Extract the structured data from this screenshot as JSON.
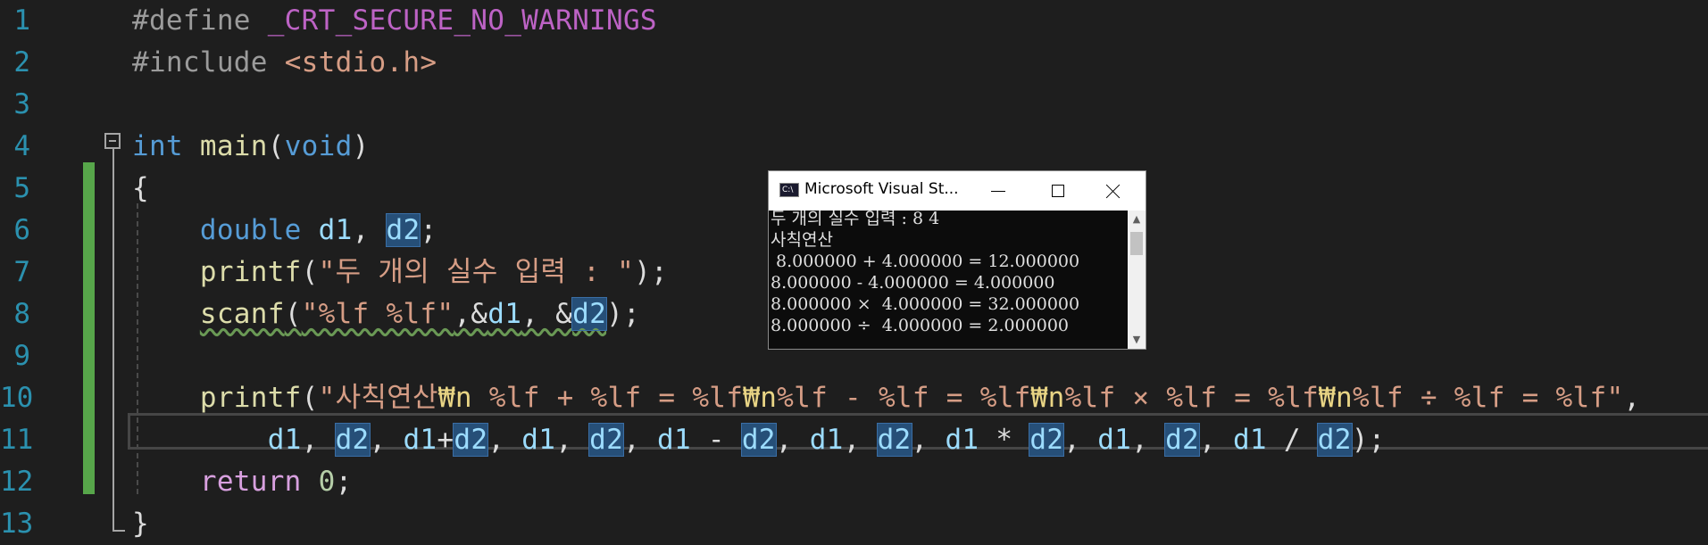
{
  "editor": {
    "line_numbers": [
      "1",
      "2",
      "3",
      "4",
      "5",
      "6",
      "7",
      "8",
      "9",
      "10",
      "11",
      "12",
      "13"
    ],
    "lines": {
      "l1": {
        "pre": "#define",
        "macro": "_CRT_SECURE_NO_WARNINGS"
      },
      "l2": {
        "pre": "#include",
        "header": "<stdio.h>"
      },
      "l4": {
        "kw": "int",
        "fn": "main",
        "open": "(",
        "param": "void",
        "close": ")"
      },
      "l5": {
        "brace": "{"
      },
      "l6": {
        "kw": "double",
        "v1": "d1",
        "comma": ",",
        "v2": "d2",
        "semi": ";"
      },
      "l7": {
        "fn": "printf",
        "open": "(",
        "str": "\"두 개의 실수 입력 : \"",
        "close": ");"
      },
      "l8": {
        "fn": "scanf",
        "open": "(",
        "str": "\"%lf %lf\"",
        "a": ",&",
        "v1": "d1",
        "b": ", &",
        "v2": "d2",
        "close": ");"
      },
      "l10": {
        "fn": "printf",
        "open": "(",
        "s1": "\"사칙연산",
        "e1": "₩n",
        "s2": " %lf + %lf = %lf",
        "e2": "₩n",
        "s3": "%lf - %lf = %lf",
        "e3": "₩n",
        "s4": "%lf × %lf = %lf",
        "e4": "₩n",
        "s5": "%lf ÷ %lf = %lf\"",
        "tail": ","
      },
      "l11": {
        "p1": "d1",
        "s1": ", ",
        "p2": "d2",
        "s2": ", ",
        "p3": "d1",
        "s3": "+",
        "p4": "d2",
        "s4": ", ",
        "p5": "d1",
        "s5": ", ",
        "p6": "d2",
        "s6": ", ",
        "p7": "d1",
        "s7": " - ",
        "p8": "d2",
        "s8": ", ",
        "p9": "d1",
        "s9": ", ",
        "p10": "d2",
        "s10": ", ",
        "p11": "d1",
        "s11": " * ",
        "p12": "d2",
        "s12": ", ",
        "p13": "d1",
        "s13": ", ",
        "p14": "d2",
        "s14": ", ",
        "p15": "d1",
        "s15": " / ",
        "p16": "d2",
        "end": ");"
      },
      "l12": {
        "kw": "return",
        "num": "0",
        "semi": ";"
      },
      "l13": {
        "brace": "}"
      }
    }
  },
  "console": {
    "title": "Microsoft Visual St...",
    "icon_text": "C:\\",
    "output": [
      "두 개의 실수 입력 : 8 4",
      "사칙연산",
      " 8.000000 + 4.000000 = 12.000000",
      "8.000000 - 4.000000 = 4.000000",
      "8.000000 ×  4.000000 = 32.000000",
      "8.000000 ÷  4.000000 = 2.000000"
    ],
    "scroll_up": "▲",
    "scroll_down": "▼"
  },
  "colors": {
    "background": "#1e1e1e",
    "line_number": "#2b91af",
    "keyword": "#569cd6",
    "string": "#d69d85",
    "function": "#dcdcaa",
    "variable": "#9cdcfe",
    "modified_bar": "#57a64a"
  }
}
